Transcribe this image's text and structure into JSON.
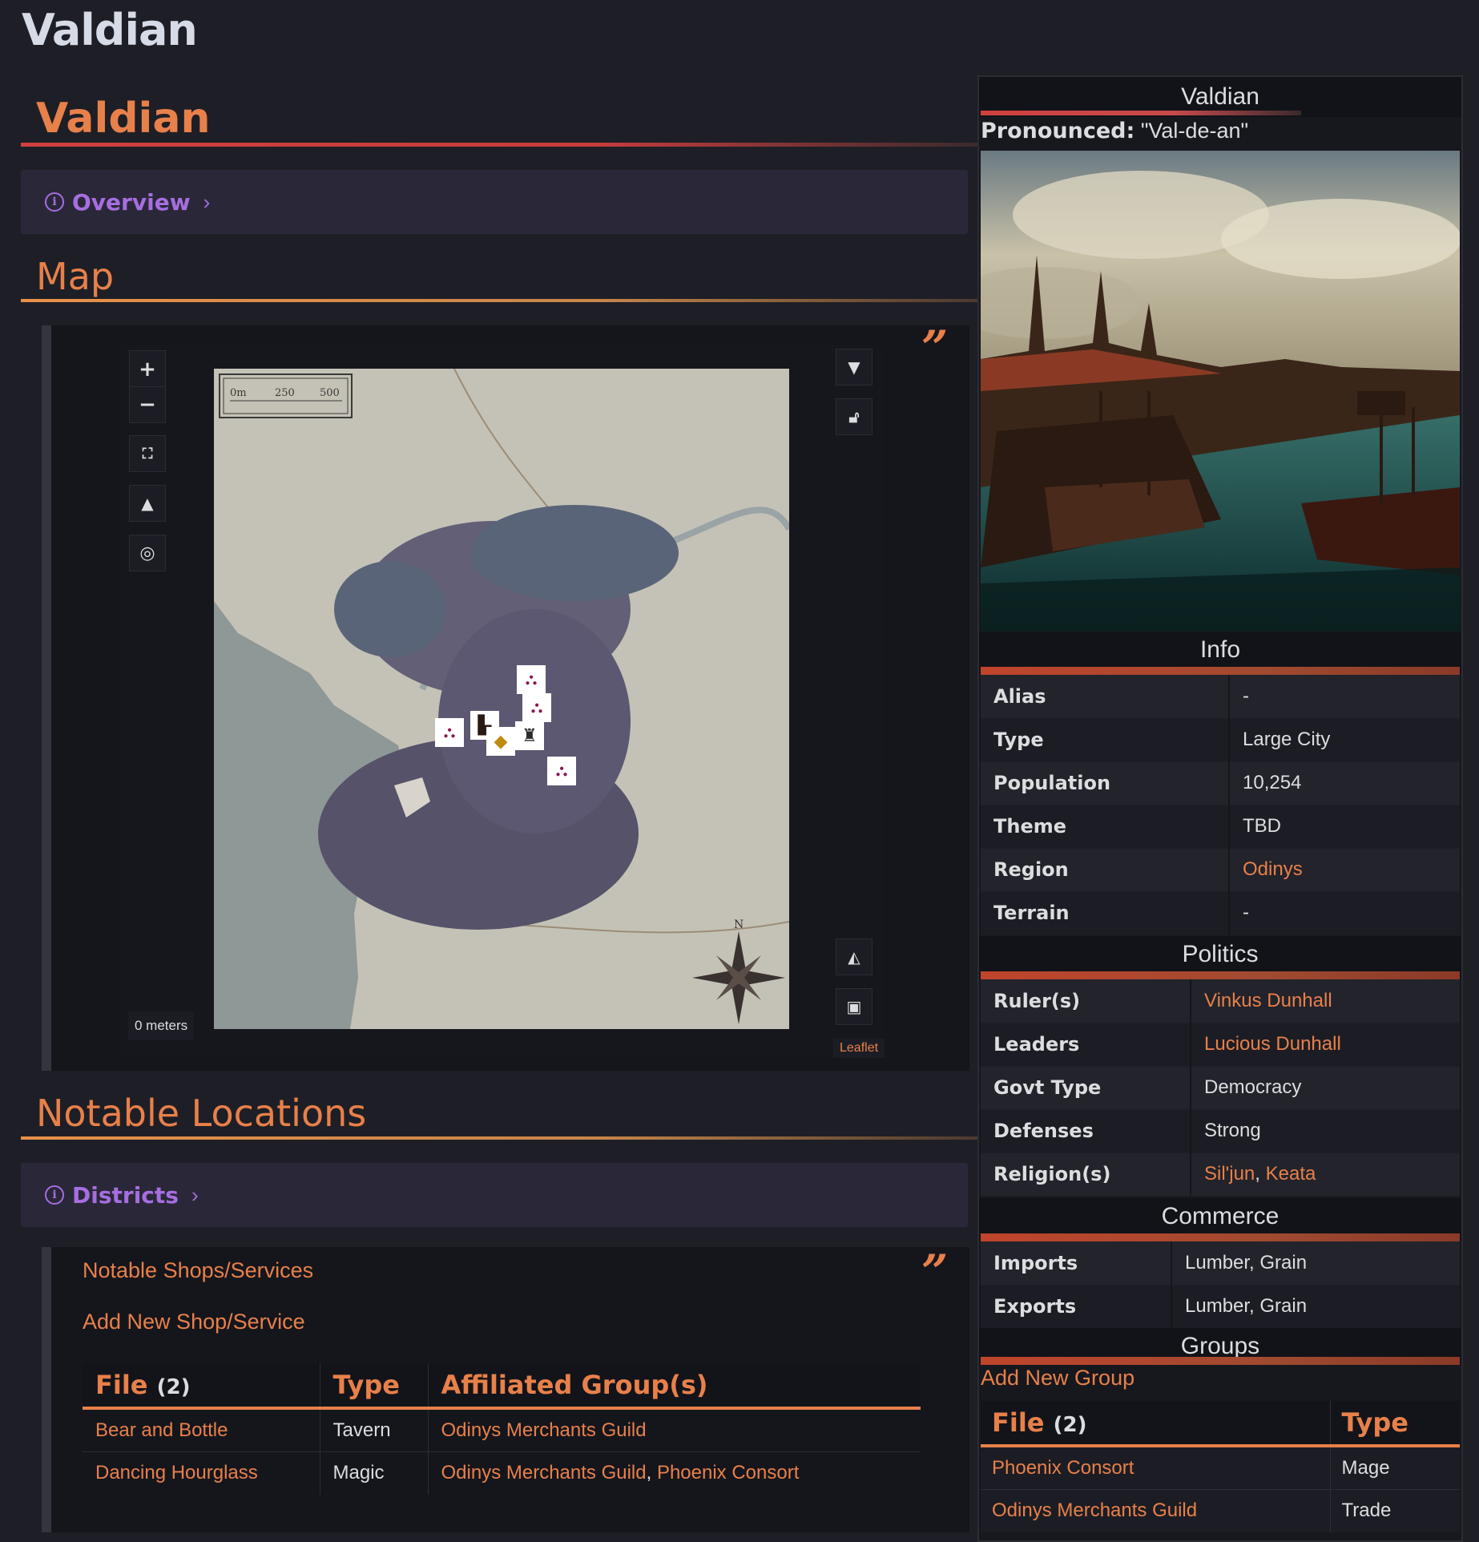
{
  "page": {
    "title": "Valdian"
  },
  "main": {
    "heading": "Valdian",
    "overview_callout": {
      "title": "Overview"
    },
    "map_heading": "Map",
    "map": {
      "scale_text": "0 meters",
      "attribution": "Leaflet",
      "scale_bar_labels": [
        "0m",
        "250",
        "500"
      ],
      "compass_label": "N"
    },
    "notable_heading": "Notable Locations",
    "districts_callout": {
      "title": "Districts"
    },
    "shops": {
      "title": "Notable Shops/Services",
      "add_link": "Add New Shop/Service",
      "columns": {
        "file": "File",
        "count": "(2)",
        "type": "Type",
        "groups": "Affiliated Group(s)"
      },
      "rows": [
        {
          "file": "Bear and Bottle",
          "type": "Tavern",
          "group1": "Odinys Merchants Guild",
          "sep": "",
          "group2": ""
        },
        {
          "file": "Dancing Hourglass",
          "type": "Magic",
          "group1": "Odinys Merchants Guild",
          "sep": ",",
          "group2": "Phoenix Consort"
        }
      ]
    }
  },
  "sidebar": {
    "title": "Valdian",
    "pronounced_label": "Pronounced:",
    "pronounced_value": "\"Val-de-an\"",
    "info_heading": "Info",
    "info": {
      "alias": {
        "k": "Alias",
        "v": "-"
      },
      "type": {
        "k": "Type",
        "v": "Large City"
      },
      "population": {
        "k": "Population",
        "v": "10,254"
      },
      "theme": {
        "k": "Theme",
        "v": "TBD"
      },
      "region": {
        "k": "Region",
        "v": "Odinys"
      },
      "terrain": {
        "k": "Terrain",
        "v": "-"
      }
    },
    "politics_heading": "Politics",
    "politics": {
      "rulers": {
        "k": "Ruler(s)",
        "v": "Vinkus Dunhall"
      },
      "leaders": {
        "k": "Leaders",
        "v": "Lucious Dunhall"
      },
      "govt": {
        "k": "Govt Type",
        "v": "Democracy"
      },
      "defenses": {
        "k": "Defenses",
        "v": "Strong"
      },
      "religions": {
        "k": "Religion(s)",
        "v1": "Sil'jun",
        "sep": ",",
        "v2": "Keata"
      }
    },
    "commerce_heading": "Commerce",
    "commerce": {
      "imports": {
        "k": "Imports",
        "v": "Lumber, Grain"
      },
      "exports": {
        "k": "Exports",
        "v": "Lumber, Grain"
      }
    },
    "groups_heading": "Groups",
    "groups": {
      "add_link": "Add New Group",
      "columns": {
        "file": "File",
        "count": "(2)",
        "type": "Type"
      },
      "rows": [
        {
          "file": "Phoenix Consort",
          "type": "Mage"
        },
        {
          "file": "Odinys Merchants Guild",
          "type": "Trade"
        }
      ]
    }
  },
  "colors": {
    "accent": "#e8804a",
    "callout": "#a66ee0",
    "background": "#1e1f26",
    "rule_red": "#d04040"
  },
  "icons": [
    "info-icon",
    "chevron-right-icon",
    "zoom-in-icon",
    "zoom-out-icon",
    "fullscreen-icon",
    "layers-icon",
    "locate-icon",
    "filter-icon",
    "unlock-icon",
    "shapes-icon",
    "save-icon",
    "compass-rose-icon",
    "binoculars-icon",
    "tag-icon",
    "tower-icon",
    "quote-icon"
  ]
}
